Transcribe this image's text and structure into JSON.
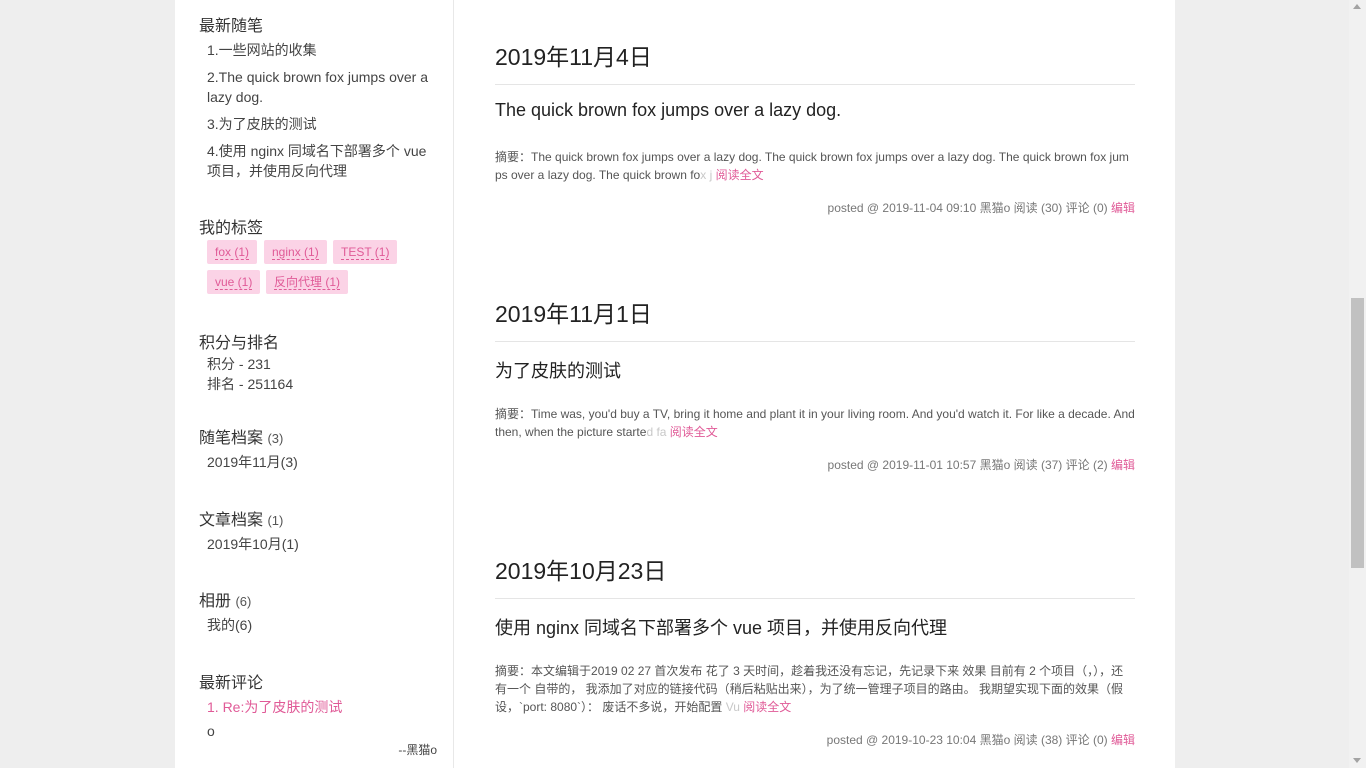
{
  "sidebar": {
    "recent_posts": {
      "title": "最新随笔",
      "items": [
        "1.一些网站的收集",
        "2.The quick brown fox jumps over a lazy dog.",
        "3.为了皮肤的测试",
        "4.使用 nginx 同域名下部署多个 vue 项目，并使用反向代理"
      ]
    },
    "tags": {
      "title": "我的标签",
      "items": [
        "fox (1)",
        "nginx (1)",
        "TEST (1)",
        "vue (1)",
        "反向代理 (1)"
      ]
    },
    "score": {
      "title": "积分与排名",
      "points": "积分 - 231",
      "rank": "排名 - 251164"
    },
    "post_archive": {
      "title": "随笔档案",
      "count": "(3)",
      "items": [
        "2019年11月(3)"
      ]
    },
    "article_archive": {
      "title": "文章档案",
      "count": "(1)",
      "items": [
        "2019年10月(1)"
      ]
    },
    "album": {
      "title": "相册",
      "count": "(6)",
      "items": [
        "我的(6)"
      ]
    },
    "recent_comments": {
      "title": "最新评论",
      "item_link": "1. Re:为了皮肤的测试",
      "item_body": "o",
      "item_author": "--黑猫o"
    }
  },
  "posts": [
    {
      "date": "2019年11月4日",
      "title": "The quick brown fox jumps over a lazy dog.",
      "summary_label": "摘要：",
      "summary": "The quick brown fox jumps over a lazy dog. The quick brown fox jumps over a lazy dog. The quick brown fox jumps over a lazy dog. The quick brown fo",
      "summary_fade": "x j",
      "read_more": "阅读全文",
      "meta": "posted @ 2019-11-04 09:10 黑猫o 阅读 (30) 评论 (0)",
      "edit": "编辑"
    },
    {
      "date": "2019年11月1日",
      "title": "为了皮肤的测试",
      "summary_label": "摘要：",
      "summary": "Time was, you'd buy a TV, bring it home and plant it in your living room. And you'd watch it. For like a decade. And then, when the picture starte",
      "summary_fade": "d fa",
      "read_more": "阅读全文",
      "meta": "posted @ 2019-11-01 10:57 黑猫o 阅读 (37) 评论 (2)",
      "edit": "编辑"
    },
    {
      "date": "2019年10月23日",
      "title": "使用 nginx 同域名下部署多个 vue 项目，并使用反向代理",
      "summary_label": "摘要：",
      "summary": "本文编辑于2019 02 27 首次发布 花了 3 天时间，趁着我还没有忘记，先记录下来 效果 目前有 2 个项目（，），还有一个 自带的， 我添加了对应的链接代码（稍后粘贴出来），为了统一管理子项目的路由。 我期望实现下面的效果（假设，`port: 8080`）： 废话不多说，开始配置",
      "summary_fade": "Vu",
      "read_more": "阅读全文",
      "meta": "posted @ 2019-10-23 10:04 黑猫o 阅读 (38) 评论 (0)",
      "edit": "编辑"
    }
  ]
}
